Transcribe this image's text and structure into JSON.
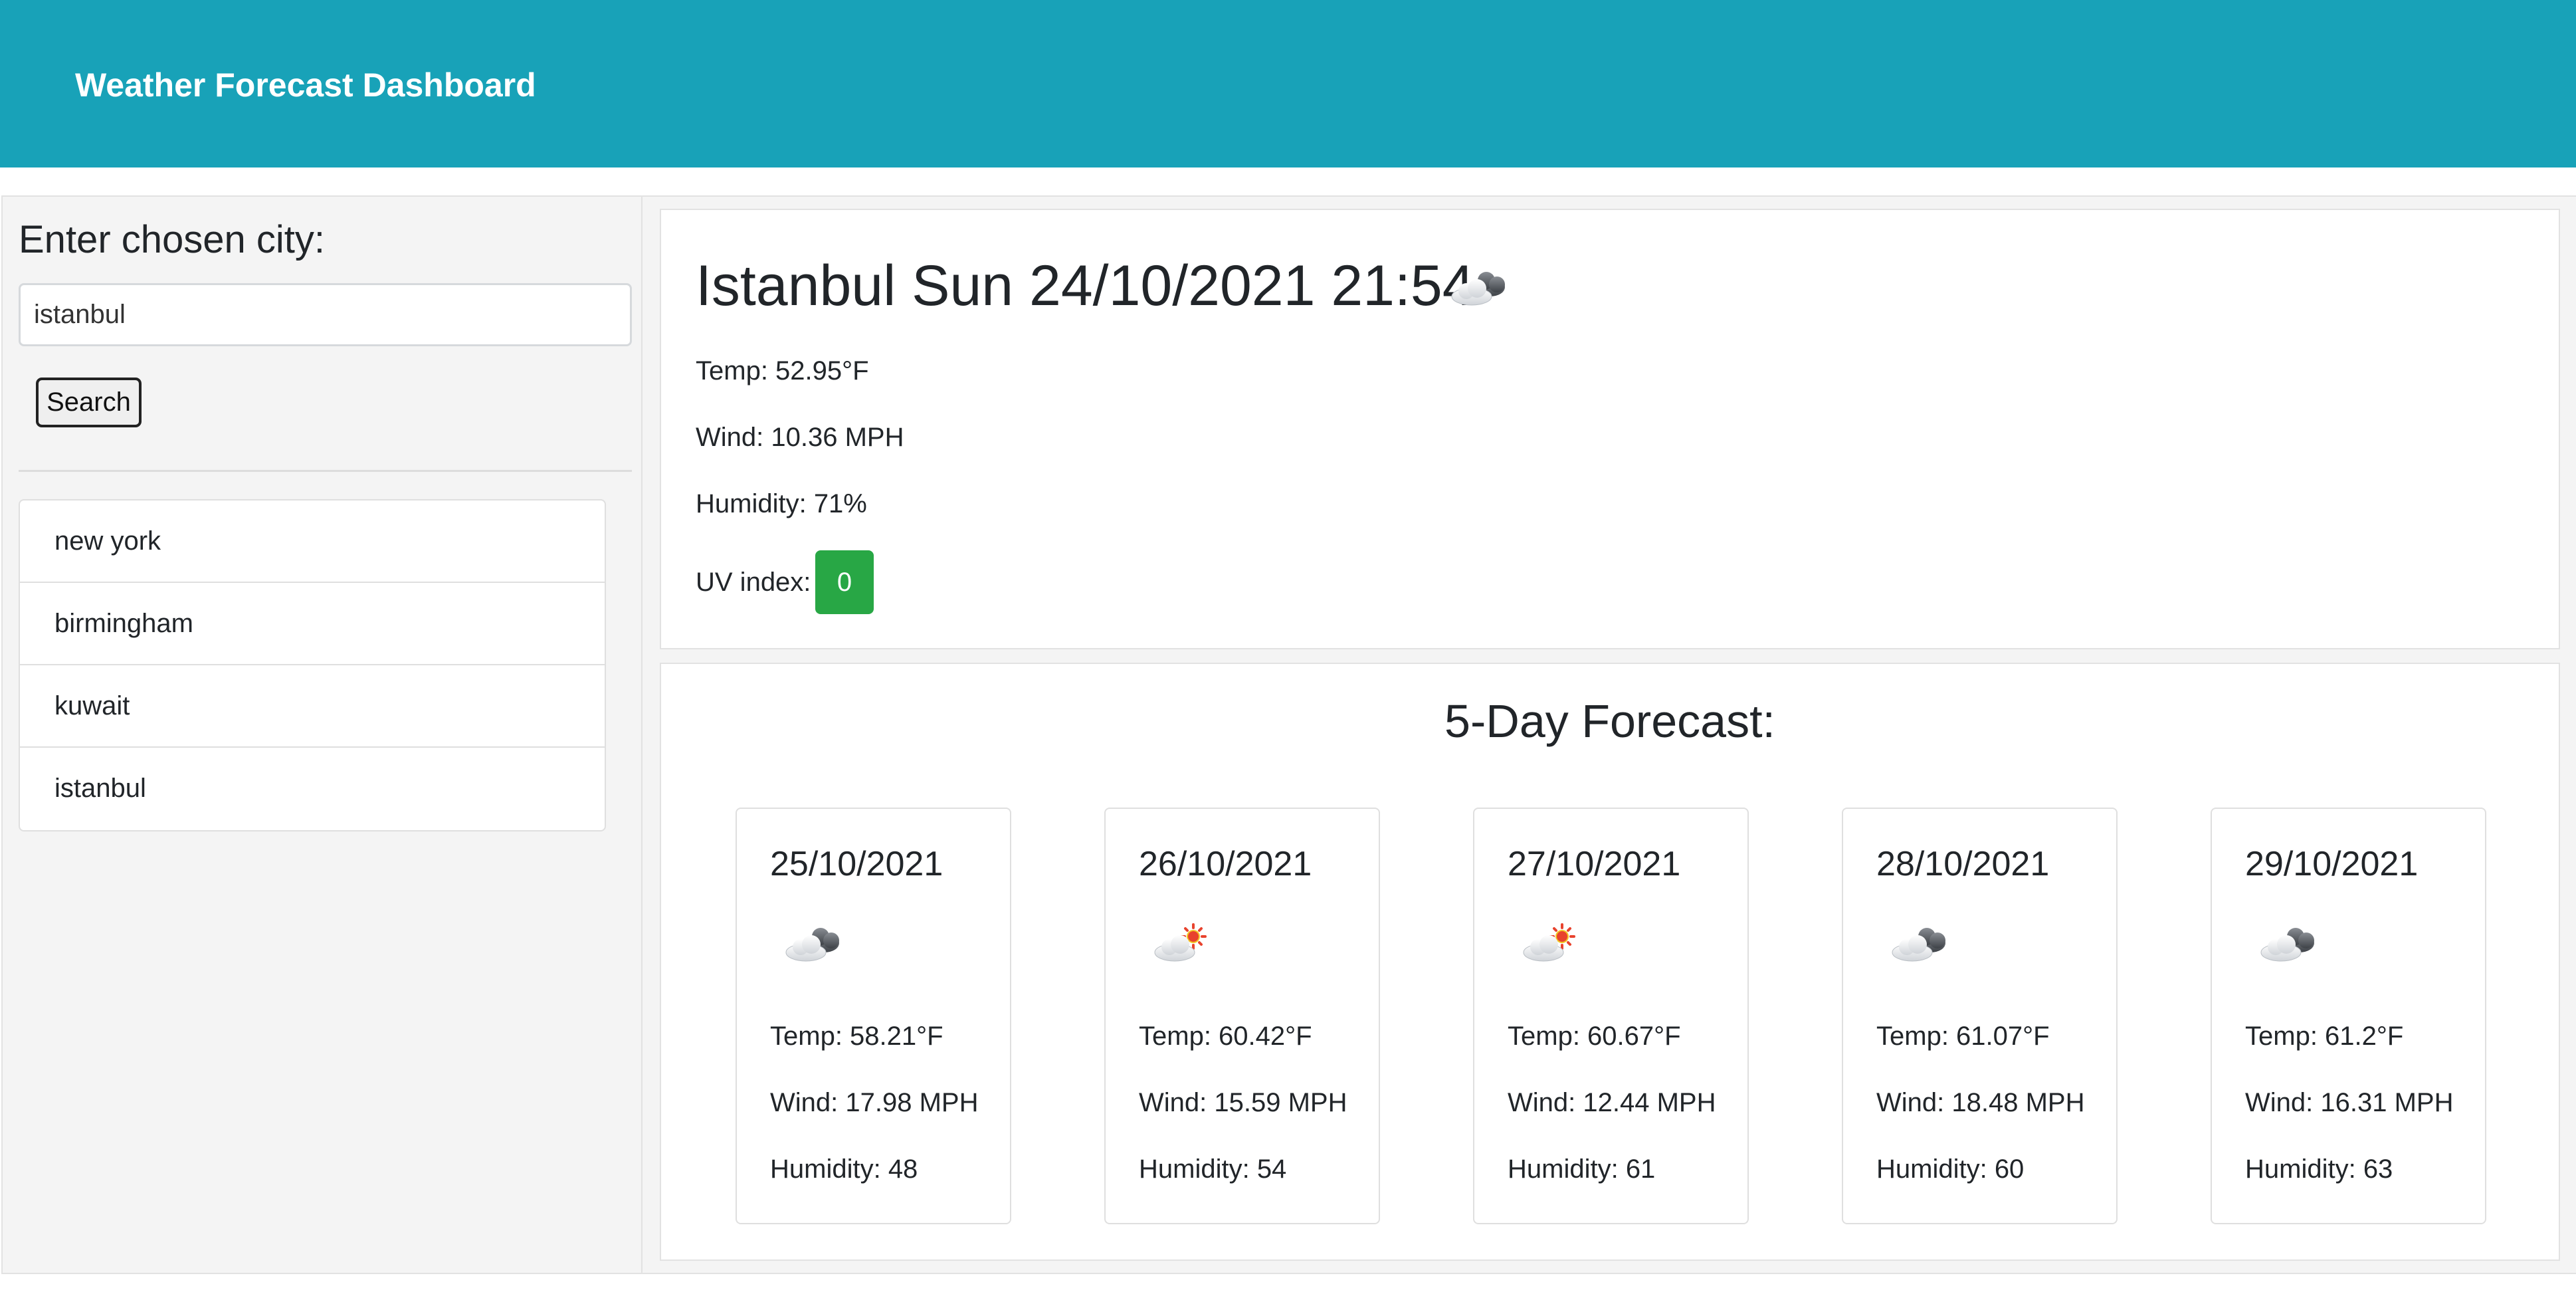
{
  "header": {
    "title": "Weather Forecast Dashboard",
    "color": "#18a2b8"
  },
  "sidebar": {
    "heading": "Enter chosen city:",
    "search_value": "istanbul",
    "search_button": "Search",
    "history": [
      "new york",
      "birmingham",
      "kuwait",
      "istanbul"
    ]
  },
  "current": {
    "title": "Istanbul Sun 24/10/2021 21:54",
    "icon": "cloudy-icon",
    "temp": "Temp: 52.95°F",
    "wind": "Wind: 10.36 MPH",
    "humidity": "Humidity: 71%",
    "uv_label": "UV index:",
    "uv_value": "0",
    "uv_color": "#28a745"
  },
  "forecast": {
    "heading": "5-Day Forecast:",
    "days": [
      {
        "date": "25/10/2021",
        "icon": "cloudy-icon",
        "temp": "Temp: 58.21°F",
        "wind": "Wind: 17.98 MPH",
        "humidity": "Humidity: 48"
      },
      {
        "date": "26/10/2021",
        "icon": "partly-sunny-icon",
        "temp": "Temp: 60.42°F",
        "wind": "Wind: 15.59 MPH",
        "humidity": "Humidity: 54"
      },
      {
        "date": "27/10/2021",
        "icon": "partly-sunny-icon",
        "temp": "Temp: 60.67°F",
        "wind": "Wind: 12.44 MPH",
        "humidity": "Humidity: 61"
      },
      {
        "date": "28/10/2021",
        "icon": "cloudy-icon",
        "temp": "Temp: 61.07°F",
        "wind": "Wind: 18.48 MPH",
        "humidity": "Humidity: 60"
      },
      {
        "date": "29/10/2021",
        "icon": "cloudy-icon",
        "temp": "Temp: 61.2°F",
        "wind": "Wind: 16.31 MPH",
        "humidity": "Humidity: 63"
      }
    ]
  }
}
